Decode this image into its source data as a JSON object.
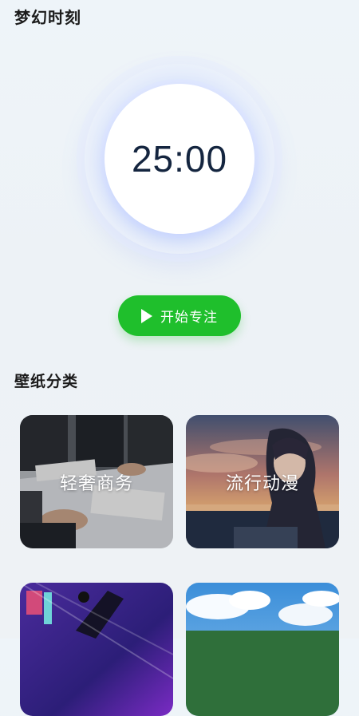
{
  "header": {
    "title": "梦幻时刻"
  },
  "timer": {
    "time": "25:00"
  },
  "start_button": {
    "label": "开始专注",
    "color": "#1fbf2c"
  },
  "wallpaper_section": {
    "title": "壁纸分类",
    "categories": [
      {
        "label": "轻奢商务",
        "image": "business-meeting-photo"
      },
      {
        "label": "流行动漫",
        "image": "anime-girl-sunset"
      },
      {
        "label": "",
        "image": "anime-action-purple"
      },
      {
        "label": "",
        "image": "sky-clouds-landscape"
      }
    ]
  }
}
